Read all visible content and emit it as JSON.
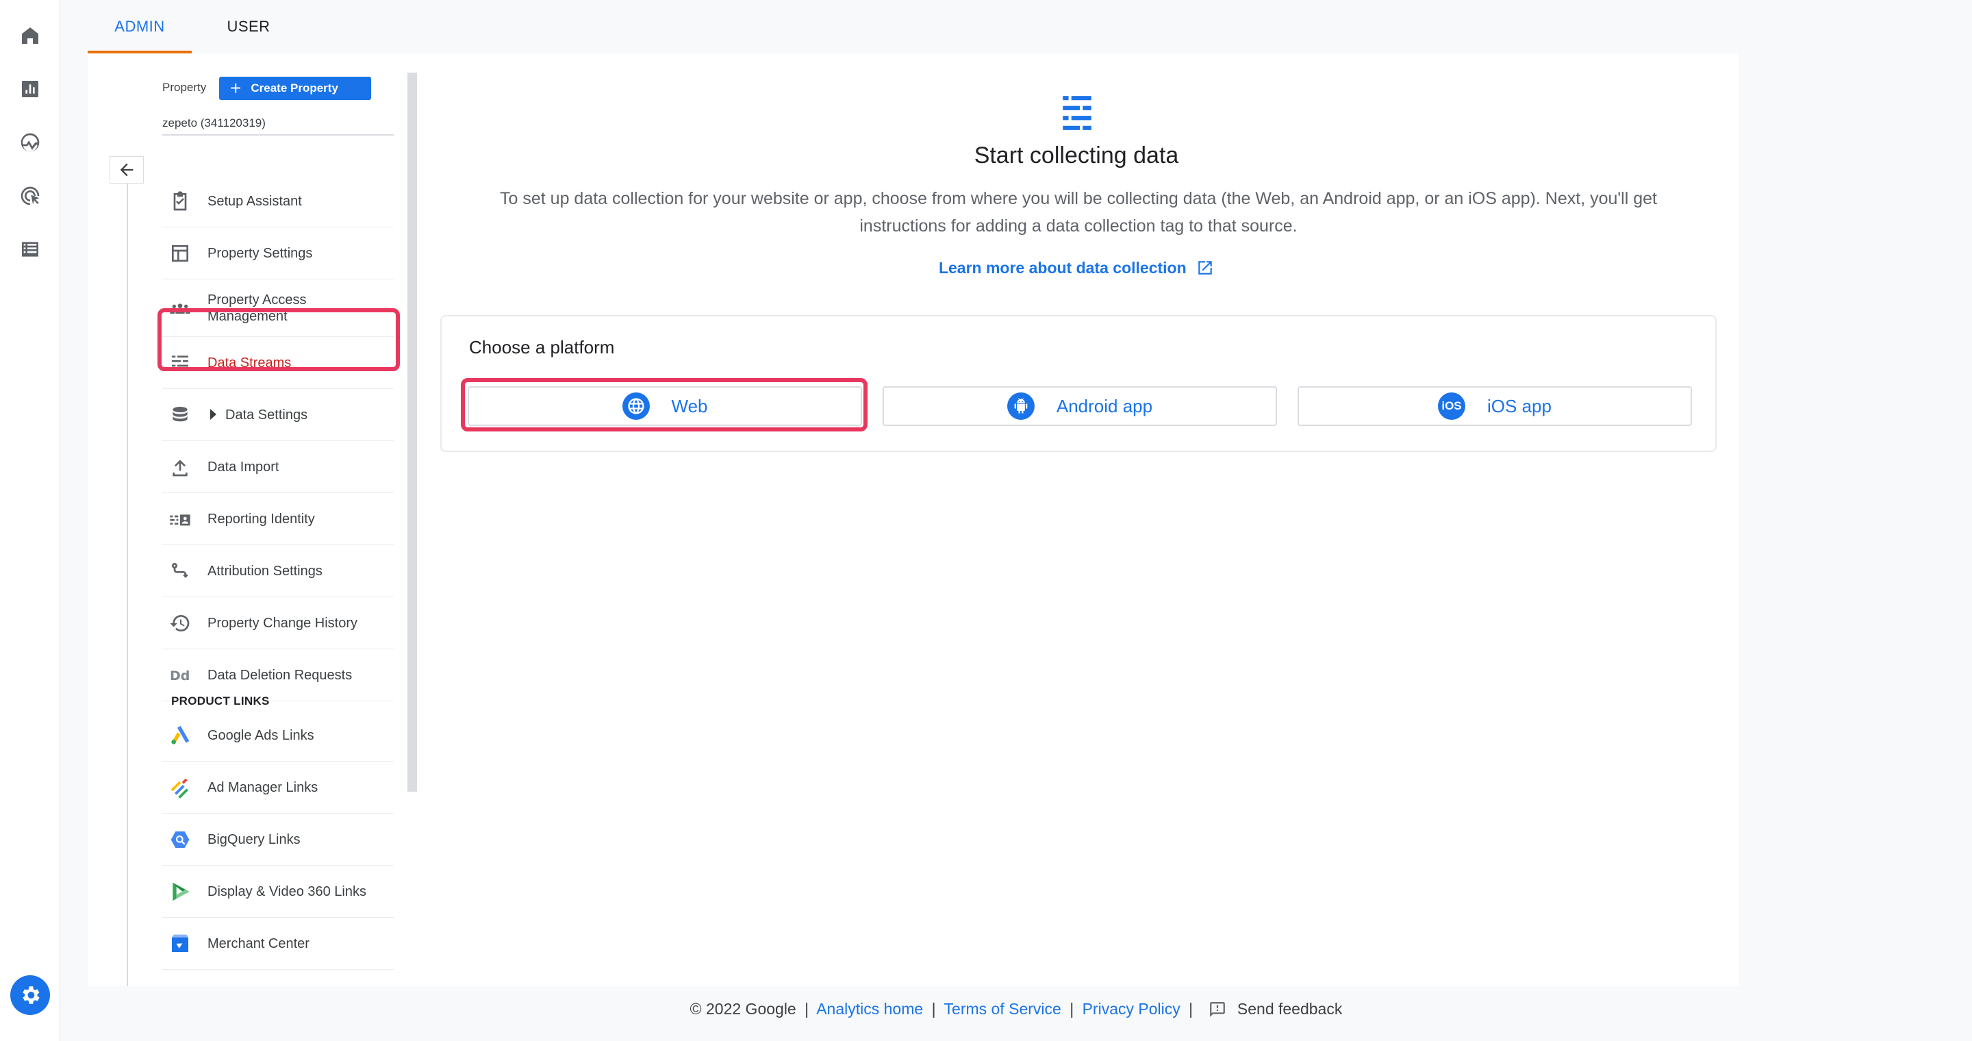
{
  "tabs": [
    {
      "label": "ADMIN",
      "active": true
    },
    {
      "label": "USER",
      "active": false
    }
  ],
  "rail": {
    "items": [
      {
        "icon": "home-icon"
      },
      {
        "icon": "reports-icon"
      },
      {
        "icon": "explore-icon"
      },
      {
        "icon": "advertising-icon"
      },
      {
        "icon": "configure-icon"
      }
    ],
    "settings_icon": "gear-icon"
  },
  "property": {
    "label": "Property",
    "create_label": "Create Property",
    "name": "zepeto (341120319)"
  },
  "nav": {
    "items": [
      {
        "label": "Setup Assistant",
        "icon": "checklist-icon"
      },
      {
        "label": "Property Settings",
        "icon": "layout-icon"
      },
      {
        "label": "Property Access Management",
        "icon": "people-icon"
      },
      {
        "label": "Data Streams",
        "icon": "data-streams-icon",
        "active": true
      },
      {
        "label": "Data Settings",
        "icon": "database-icon",
        "expandable": true
      },
      {
        "label": "Data Import",
        "icon": "upload-icon"
      },
      {
        "label": "Reporting Identity",
        "icon": "identity-icon"
      },
      {
        "label": "Attribution Settings",
        "icon": "attribution-icon"
      },
      {
        "label": "Property Change History",
        "icon": "history-icon"
      },
      {
        "label": "Data Deletion Requests",
        "icon": "dd-icon"
      }
    ],
    "section_title": "PRODUCT LINKS",
    "links": [
      {
        "label": "Google Ads Links",
        "icon": "google-ads-icon"
      },
      {
        "label": "Ad Manager Links",
        "icon": "ad-manager-icon"
      },
      {
        "label": "BigQuery Links",
        "icon": "bigquery-icon"
      },
      {
        "label": "Display & Video 360 Links",
        "icon": "dv360-icon"
      },
      {
        "label": "Merchant Center",
        "icon": "merchant-center-icon"
      }
    ]
  },
  "content": {
    "title": "Start collecting data",
    "description": "To set up data collection for your website or app, choose from where you will be collecting data (the Web, an Android app, or an iOS app). Next, you'll get instructions for adding a data collection tag to that source.",
    "learn_more": "Learn more about data collection",
    "card_title": "Choose a platform",
    "platforms": [
      {
        "label": "Web",
        "icon": "globe-icon"
      },
      {
        "label": "Android app",
        "icon": "android-icon"
      },
      {
        "label": "iOS app",
        "icon": "ios-icon",
        "badge": "iOS"
      }
    ]
  },
  "footer": {
    "copyright": "© 2022 Google",
    "analytics_home": "Analytics home",
    "terms": "Terms of Service",
    "privacy": "Privacy Policy",
    "feedback": "Send feedback",
    "separator": "|"
  },
  "colors": {
    "accent": "#1a73e8",
    "active_tab_underline": "#e8710a",
    "highlight": "#e8375e",
    "active_nav_text": "#c5221f"
  }
}
